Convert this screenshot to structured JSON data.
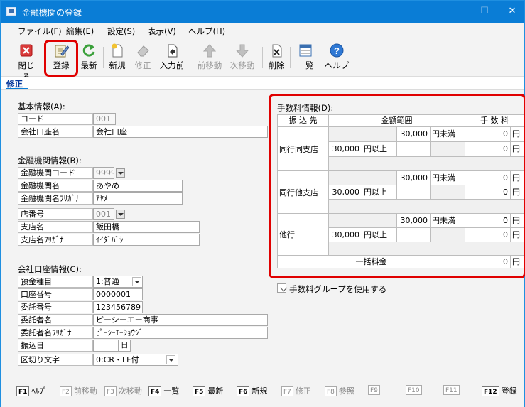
{
  "window": {
    "title": "金融機関の登録",
    "minimize": "—",
    "maximize": "☐",
    "close": "✕"
  },
  "menu": [
    "ファイル(F)",
    "編集(E)",
    "設定(S)",
    "表示(V)",
    "ヘルプ(H)"
  ],
  "toolbar": {
    "close": "閉じる",
    "register": "登録",
    "latest": "最新",
    "new": "新規",
    "edit": "修正",
    "before_input": "入力前",
    "prev": "前移動",
    "next": "次移動",
    "delete": "削除",
    "list": "一覧",
    "help": "ヘルプ"
  },
  "mode_tab": "修正",
  "basic": {
    "header": "基本情報(A):",
    "code_label": "コード",
    "code_value": "001",
    "account_name_label": "会社口座名",
    "account_name_value": "会社口座"
  },
  "institution": {
    "header": "金融機関情報(B):",
    "code_label": "金融機関コード",
    "code_value": "9999",
    "name_label": "金融機関名",
    "name_value": "あやめ",
    "kana_label": "金融機関名ﾌﾘｶﾞﾅ",
    "kana_value": "ｱﾔﾒ",
    "branch_no_label": "店番号",
    "branch_no_value": "001",
    "branch_name_label": "支店名",
    "branch_name_value": "飯田橋",
    "branch_kana_label": "支店名ﾌﾘｶﾞﾅ",
    "branch_kana_value": "ｲｲﾀﾞﾊﾞｼ"
  },
  "account": {
    "header": "会社口座情報(C):",
    "type_label": "預金種目",
    "type_value": "1:普通",
    "number_label": "口座番号",
    "number_value": "0000001",
    "consignor_no_label": "委託番号",
    "consignor_no_value": "123456789",
    "consignor_name_label": "委託者名",
    "consignor_name_value": "ピーシーエー商事",
    "consignor_kana_label": "委託者名ﾌﾘｶﾞﾅ",
    "consignor_kana_value": "ﾋﾟｰｼｰｴｰｼｮｳｼﾞ",
    "transfer_date_label": "振込日",
    "transfer_date_icon": "日",
    "delimiter_label": "区切り文字",
    "delimiter_value": "0:CR・LF付"
  },
  "fees": {
    "header": "手数料情報(D):",
    "col_dest": "振 込 先",
    "col_range": "金額範囲",
    "col_fee": "手 数 料",
    "rows": [
      {
        "label": "同行同支店",
        "under_amount": "30,000",
        "under_text": "円未満",
        "over_amount": "30,000",
        "over_text": "円以上",
        "fee_under": "0",
        "fee_over": "0"
      },
      {
        "label": "同行他支店",
        "under_amount": "30,000",
        "under_text": "円未満",
        "over_amount": "30,000",
        "over_text": "円以上",
        "fee_under": "0",
        "fee_over": "0"
      },
      {
        "label": "他行",
        "under_amount": "30,000",
        "under_text": "円未満",
        "over_amount": "30,000",
        "over_text": "円以上",
        "fee_under": "0",
        "fee_over": "0"
      }
    ],
    "yen": "円",
    "flat_label": "一括料金",
    "flat_value": "0",
    "group_checkbox": "手数料グループを使用する"
  },
  "fkeys": [
    {
      "key": "F1",
      "label": "ﾍﾙﾌﾟ"
    },
    {
      "key": "F2",
      "label": "前移動"
    },
    {
      "key": "F3",
      "label": "次移動"
    },
    {
      "key": "F4",
      "label": "一覧"
    },
    {
      "key": "F5",
      "label": "最新"
    },
    {
      "key": "F6",
      "label": "新規"
    },
    {
      "key": "F7",
      "label": "修正"
    },
    {
      "key": "F8",
      "label": "参照"
    },
    {
      "key": "F9",
      "label": ""
    },
    {
      "key": "F10",
      "label": ""
    },
    {
      "key": "F11",
      "label": ""
    },
    {
      "key": "F12",
      "label": "登録"
    }
  ],
  "colors": {
    "titlebar": "#0a7dd6",
    "highlight": "#e00000"
  }
}
